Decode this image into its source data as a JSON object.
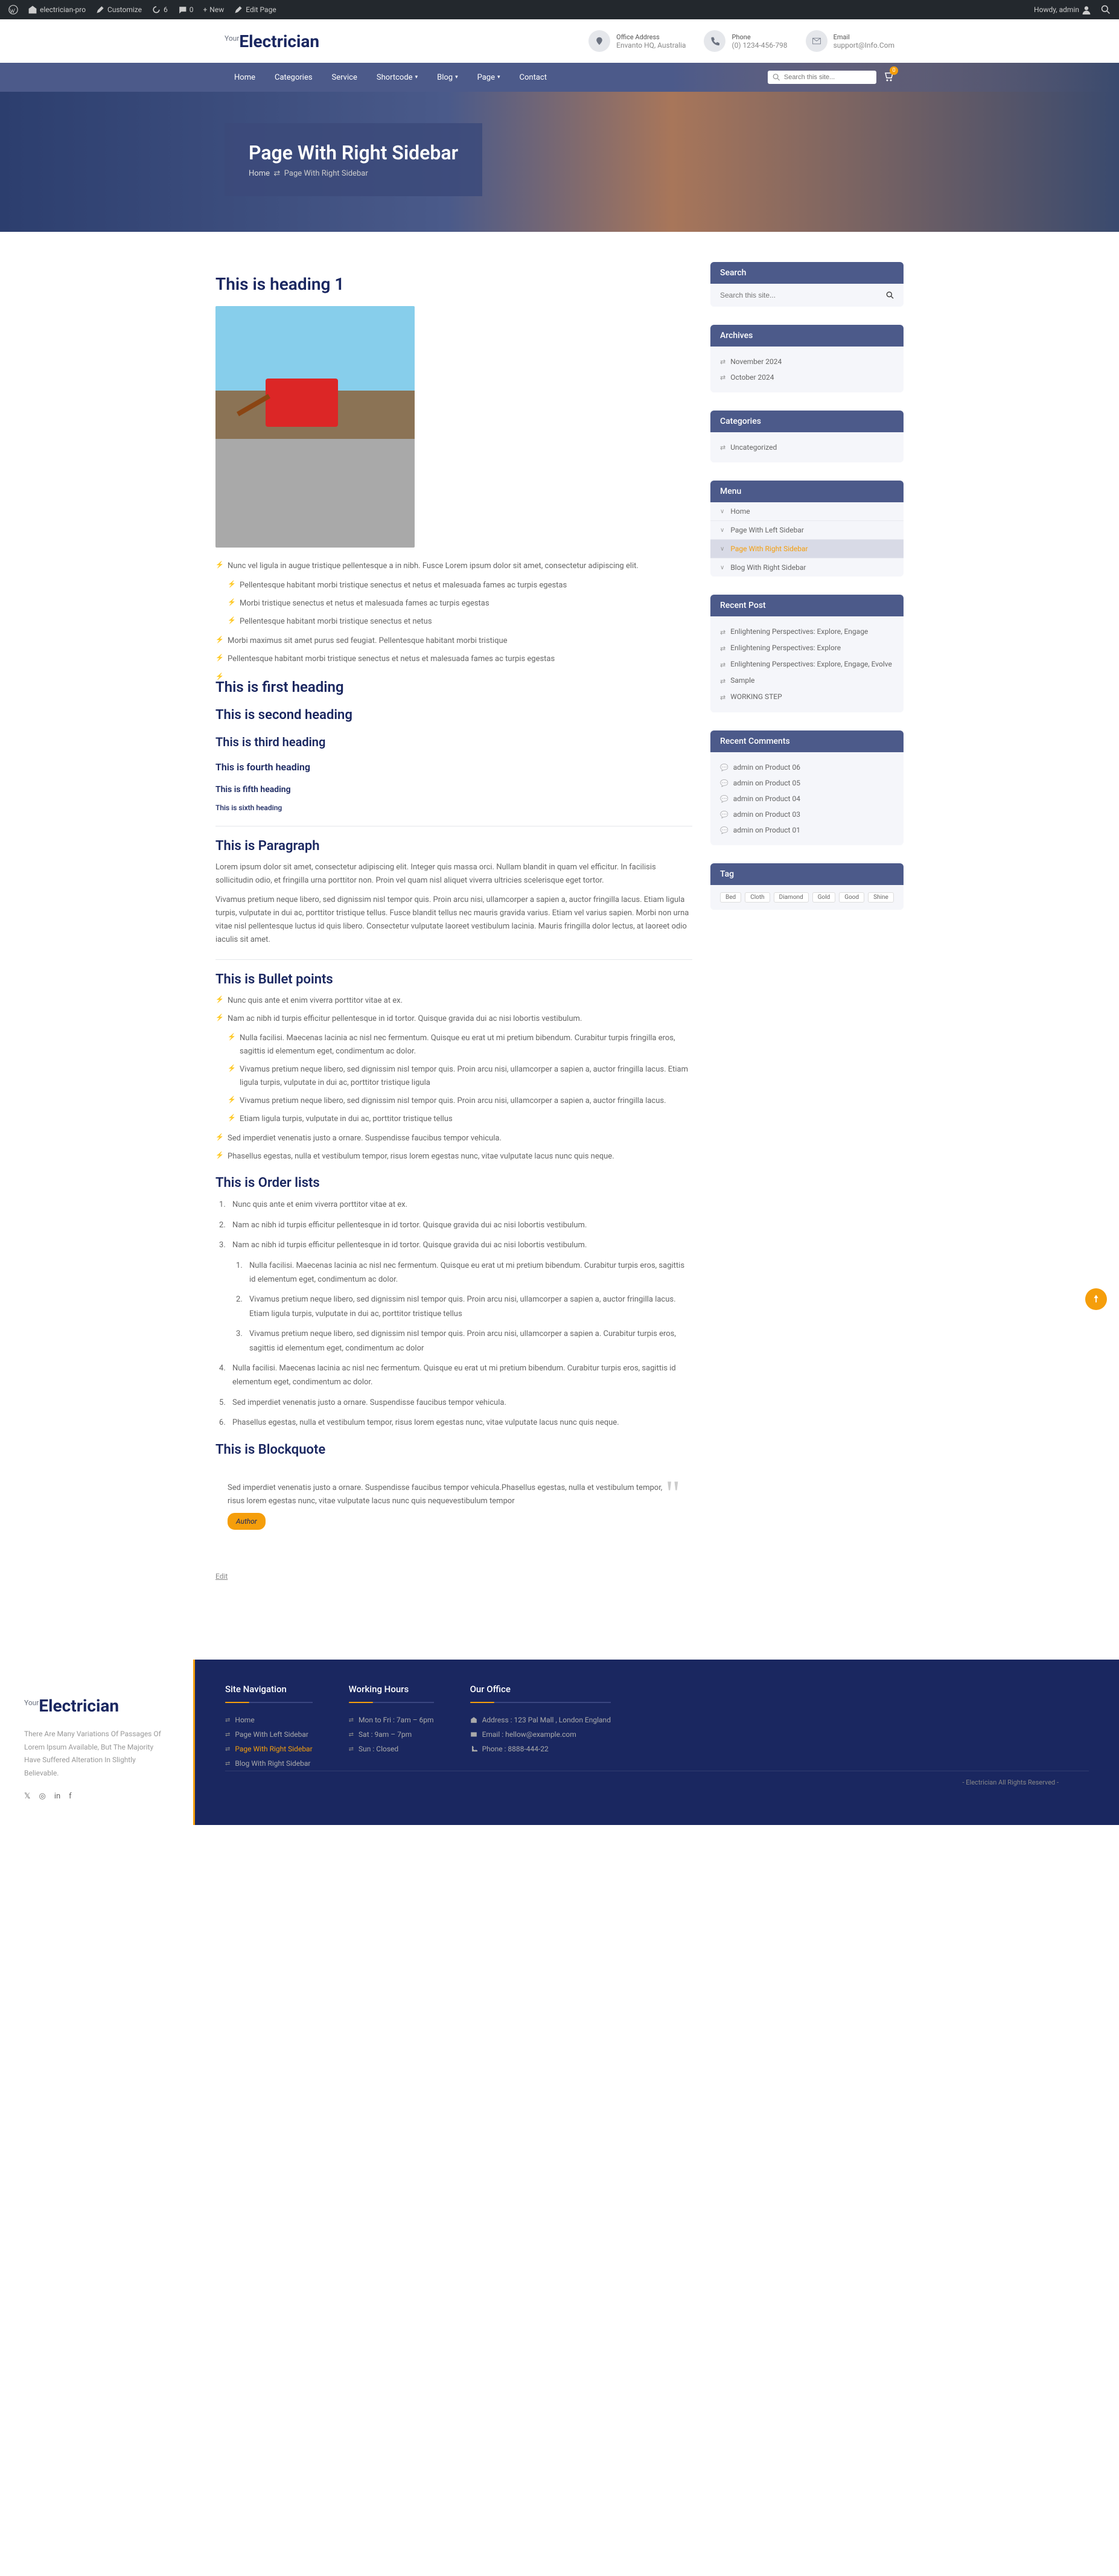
{
  "adminBar": {
    "site": "electrician-pro",
    "customize": "Customize",
    "updates": "6",
    "comments": "0",
    "new": "New",
    "editPage": "Edit Page",
    "howdy": "Howdy, admin"
  },
  "header": {
    "logoPrefix": "Your",
    "logoMain": "Electrician",
    "office": {
      "label": "Office Address",
      "value": "Envanto HQ, Australia"
    },
    "phone": {
      "label": "Phone",
      "value": "(0) 1234-456-798"
    },
    "email": {
      "label": "Email",
      "value": "support@Info.Com"
    }
  },
  "nav": {
    "items": [
      "Home",
      "Categories",
      "Service",
      "Shortcode",
      "Blog",
      "Page",
      "Contact"
    ],
    "searchPlaceholder": "Search this site...",
    "cartCount": "0"
  },
  "hero": {
    "title": "Page With Right Sidebar",
    "crumbHome": "Home",
    "crumbCurrent": "Page With Right Sidebar"
  },
  "content": {
    "h1": "This is heading 1",
    "para1": "Nunc vel ligula in augue tristique pellentesque a in nibh. Fusce Lorem ipsum dolor sit amet, consectetur adipiscing elit.",
    "sub1": "Pellentesque habitant morbi tristique senectus et netus et malesuada fames ac turpis egestas",
    "sub2": "Morbi tristique senectus et netus et malesuada fames ac turpis egestas",
    "sub3": "Pellentesque habitant morbi tristique senectus et netus",
    "para2": "Morbi maximus sit amet purus sed feugiat. Pellentesque habitant morbi tristique",
    "para3": "Pellentesque habitant morbi tristique senectus et netus et malesuada fames ac turpis egestas",
    "h2": "This is first heading",
    "h3": "This is second heading",
    "h4": "This is third heading",
    "h5": "This is fourth heading",
    "h6": "This is fifth heading",
    "h7": "This is sixth heading",
    "paraHeading": "This is Paragraph",
    "paraText": "Lorem ipsum dolor sit amet, consectetur adipiscing elit. Integer quis massa orci. Nullam blandit in quam vel efficitur. In facilisis sollicitudin odio, et fringilla urna porttitor non. Proin vel quam nisl aliquet viverra ultricies scelerisque eget tortor.",
    "paraText2": "Vivamus pretium neque libero, sed dignissim nisl tempor quis. Proin arcu nisi, ullamcorper a sapien a, auctor fringilla lacus. Etiam ligula turpis, vulputate in dui ac, porttitor tristique tellus. Fusce blandit tellus nec mauris gravida varius. Etiam vel varius sapien. Morbi non urna vitae nisl pellentesque luctus id quis libero. Consectetur vulputate laoreet vestibulum lacinia. Mauris fringilla dolor lectus, at laoreet odio iaculis sit amet.",
    "bulletHeading": "This is Bullet points",
    "bullets": {
      "b1": "Nunc quis ante et enim viverra porttitor vitae at ex.",
      "b2": "Nam ac nibh id turpis efficitur pellentesque in id tortor. Quisque gravida dui ac nisi lobortis vestibulum.",
      "b3": "Nulla facilisi. Maecenas lacinia ac nisl nec fermentum. Quisque eu erat ut mi pretium bibendum. Curabitur turpis fringilla eros, sagittis id elementum eget, condimentum ac dolor.",
      "b4": "Vivamus pretium neque libero, sed dignissim nisl tempor quis. Proin arcu nisi, ullamcorper a sapien a, auctor fringilla lacus. Etiam ligula turpis, vulputate in dui ac, porttitor tristique ligula",
      "b5": "Vivamus pretium neque libero, sed dignissim nisl tempor quis. Proin arcu nisi, ullamcorper a sapien a, auctor fringilla lacus.",
      "b6": "Etiam ligula turpis, vulputate in dui ac, porttitor tristique tellus",
      "b7": "Sed imperdiet venenatis justo a ornare. Suspendisse faucibus tempor vehicula.",
      "b8": "Phasellus egestas, nulla et vestibulum tempor, risus lorem egestas nunc, vitae vulputate lacus nunc quis neque."
    },
    "orderHeading": "This is Order lists",
    "orders": {
      "o1": "Nunc quis ante et enim viverra porttitor vitae at ex.",
      "o2": "Nam ac nibh id turpis efficitur pellentesque in id tortor. Quisque gravida dui ac nisi lobortis vestibulum.",
      "o3": "Nam ac nibh id turpis efficitur pellentesque in id tortor. Quisque gravida dui ac nisi lobortis vestibulum.",
      "o3a": "Nulla facilisi. Maecenas lacinia ac nisl nec fermentum. Quisque eu erat ut mi pretium bibendum. Curabitur turpis eros, sagittis id elementum eget, condimentum ac dolor.",
      "o3b": "Vivamus pretium neque libero, sed dignissim nisl tempor quis. Proin arcu nisi, ullamcorper a sapien a, auctor fringilla lacus. Etiam ligula turpis, vulputate in dui ac, porttitor tristique tellus",
      "o3c": "Vivamus pretium neque libero, sed dignissim nisl tempor quis. Proin arcu nisi, ullamcorper a sapien a. Curabitur turpis eros, sagittis id elementum eget, condimentum ac dolor",
      "o4": "Nulla facilisi. Maecenas lacinia ac nisl nec fermentum. Quisque eu erat ut mi pretium bibendum. Curabitur turpis eros, sagittis id elementum eget, condimentum ac dolor.",
      "o5": "Sed imperdiet venenatis justo a ornare. Suspendisse faucibus tempor vehicula.",
      "o6": "Phasellus egestas, nulla et vestibulum tempor, risus lorem egestas nunc, vitae vulputate lacus nunc quis neque."
    },
    "blockHeading": "This is Blockquote",
    "blockText": "Sed imperdiet venenatis justo a ornare. Suspendisse faucibus tempor vehicula.Phasellus egestas, nulla et vestibulum tempor, risus lorem egestas nunc, vitae vulputate lacus nunc quis nequevestibulum tempor",
    "author": "Author",
    "edit": "Edit"
  },
  "sidebar": {
    "search": {
      "title": "Search",
      "placeholder": "Search this site..."
    },
    "archives": {
      "title": "Archives",
      "items": [
        "November 2024",
        "October 2024"
      ]
    },
    "categories": {
      "title": "Categories",
      "items": [
        "Uncategorized"
      ]
    },
    "menu": {
      "title": "Menu",
      "items": [
        "Home",
        "Page With Left Sidebar",
        "Page With Right Sidebar",
        "Blog With Right Sidebar"
      ]
    },
    "recent": {
      "title": "Recent Post",
      "items": [
        "Enlightening Perspectives: Explore, Engage",
        "Enlightening Perspectives: Explore",
        "Enlightening Perspectives: Explore, Engage, Evolve",
        "Sample",
        "WORKING STEP"
      ]
    },
    "comments": {
      "title": "Recent Comments",
      "items": [
        {
          "author": "admin",
          "on": "on",
          "post": "Product 06"
        },
        {
          "author": "admin",
          "on": "on",
          "post": "Product 05"
        },
        {
          "author": "admin",
          "on": "on",
          "post": "Product 04"
        },
        {
          "author": "admin",
          "on": "on",
          "post": "Product 03"
        },
        {
          "author": "admin",
          "on": "on",
          "post": "Product 01"
        }
      ]
    },
    "tag": {
      "title": "Tag",
      "items": [
        "Bed",
        "Cloth",
        "Diamond",
        "Gold",
        "Good",
        "Shine"
      ]
    }
  },
  "footer": {
    "about": "There Are Many Variations Of Passages Of Lorem Ipsum Available, But The Majority Have Suffered Alteration In Slightly Believable.",
    "navTitle": "Site Navigation",
    "navItems": [
      "Home",
      "Page With Left Sidebar",
      "Page With Right Sidebar",
      "Blog With Right Sidebar"
    ],
    "hoursTitle": "Working Hours",
    "hoursItems": [
      "Mon to Fri : 7am – 6pm",
      "Sat : 9am – 7pm",
      "Sun : Closed"
    ],
    "officeTitle": "Our Office",
    "officeAddr": "Address : 123 Pal Mall , London England",
    "officeEmail": "Email : hellow@example.com",
    "officePhone": "Phone : 8888-444-22",
    "copyright": "- Electrician All Rights Reserved -"
  }
}
